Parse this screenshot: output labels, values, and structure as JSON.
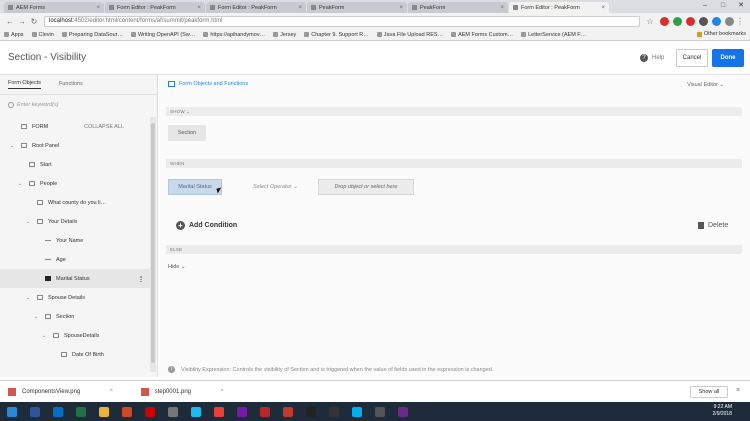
{
  "browser": {
    "tabs": [
      {
        "label": "AEM Forms",
        "active": false
      },
      {
        "label": "Form Editor : PeakForm",
        "active": false
      },
      {
        "label": "Form Editor : PeakForm",
        "active": false
      },
      {
        "label": "PeakForm",
        "active": false
      },
      {
        "label": "PeakForm",
        "active": false
      },
      {
        "label": "Form Editor : PeakForm",
        "active": true
      }
    ],
    "url_host": "localhost",
    "url_path": ":4502/editor.html/content/forms/af/summit/peakform.html",
    "bookmarks": [
      "Apps",
      "Clevin",
      "Preparing DataSour…",
      "Writing OpenAPI (Sw…",
      "https://apihandymov…",
      "Jersey",
      "Chapter 9. Support R…",
      "Java File Upload RES…",
      "AEM Forms Custom…",
      "LetterService (AEM F…"
    ],
    "other_bookmarks": "Other bookmarks"
  },
  "header": {
    "title": "Section - Visibility",
    "help": "Help",
    "cancel": "Cancel",
    "done": "Done"
  },
  "left": {
    "tabs": [
      "Form Objects",
      "Functions"
    ],
    "filter_placeholder": "Enter keyword(s)",
    "form_label": "FORM",
    "collapse_all": "COLLAPSE ALL",
    "tree": [
      {
        "label": "Root Panel"
      },
      {
        "label": "Start"
      },
      {
        "label": "People"
      },
      {
        "label": "What county do you li…"
      },
      {
        "label": "Your Details"
      },
      {
        "label": "Your Name"
      },
      {
        "label": "Age"
      },
      {
        "label": "Marital Status"
      },
      {
        "label": "Spouse Details"
      },
      {
        "label": "Section"
      },
      {
        "label": "SpouseDetails"
      },
      {
        "label": "Date Of Birth"
      }
    ]
  },
  "main": {
    "heading": "Form Objects and Functions",
    "visual_editor": "Visual Editor",
    "show_label": "SHOW",
    "show_value": "Section",
    "when_label": "WHEN",
    "when_field": "Marital Status",
    "operator_placeholder": "Select Operator",
    "drop_placeholder": "Drop object or select here",
    "add_condition": "Add Condition",
    "delete": "Delete",
    "else_label": "ELSE",
    "else_value": "Hide",
    "expression_note": "Visibility Expression: Controls the visibility of Section and is triggered when the value of fields used in the expression is changed."
  },
  "downloads": {
    "items": [
      "ComponentsView.png",
      "step0001.png"
    ],
    "show_all": "Show all"
  },
  "taskbar": {
    "time": "9:22 AM",
    "date": "2/9/2018"
  }
}
